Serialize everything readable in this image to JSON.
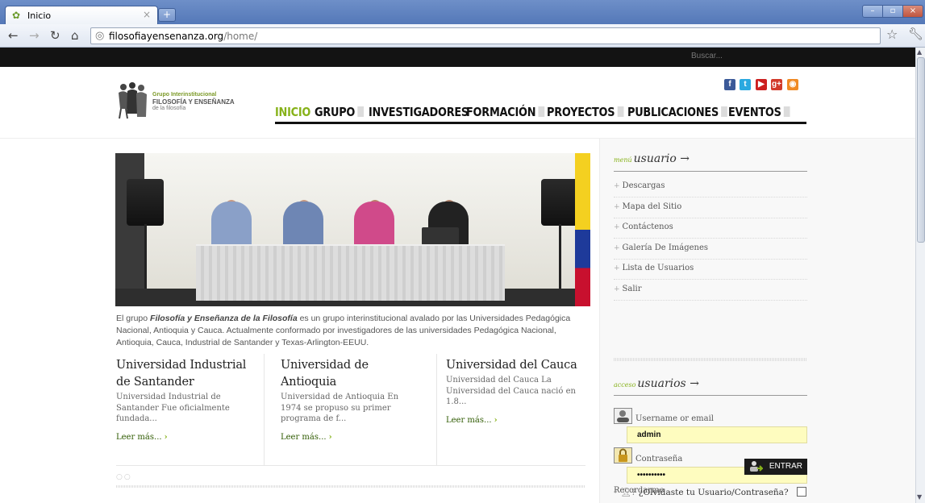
{
  "browser": {
    "tab_title": "Inicio",
    "tab_close": "×",
    "new_tab": "+",
    "url_host": "filosofiayensenanza.org",
    "url_path": "/home/",
    "win_min": "–",
    "win_max": "▫",
    "win_close": "×"
  },
  "site": {
    "search_placeholder": "Buscar...",
    "logo": {
      "line1": "Grupo Interinstitucional",
      "line2_a": "FILOSOFÍA Y ENSEÑANZA",
      "line3": "de la filosofía"
    },
    "social": [
      {
        "icon": "facebook-icon",
        "glyph": "f",
        "color": "#3b5998"
      },
      {
        "icon": "twitter-icon",
        "glyph": "t",
        "color": "#2aa9e0"
      },
      {
        "icon": "youtube-icon",
        "glyph": "▶",
        "color": "#cc2020"
      },
      {
        "icon": "google-plus-icon",
        "glyph": "g+",
        "color": "#d23a2a"
      },
      {
        "icon": "rss-icon",
        "glyph": "◉",
        "color": "#f08a24"
      }
    ],
    "nav": [
      {
        "label": "INICIO",
        "active": true,
        "dropdown": false
      },
      {
        "label": "GRUPO",
        "active": false,
        "dropdown": true
      },
      {
        "label": "INVESTIGADORES",
        "active": false,
        "dropdown": false
      },
      {
        "label": "FORMACIÓN",
        "active": false,
        "dropdown": true
      },
      {
        "label": "PROYECTOS",
        "active": false,
        "dropdown": true
      },
      {
        "label": "PUBLICACIONES",
        "active": false,
        "dropdown": true
      },
      {
        "label": "EVENTOS",
        "active": false,
        "dropdown": true
      }
    ],
    "intro": {
      "pre": "El grupo ",
      "bold": "Filosofía y Enseñanza de la Filosofía",
      "post": " es un grupo interinstitucional avalado por las Universidades Pedagógica Nacional, Antioquia y Cauca. Actualmente conformado por investigadores de las universidades Pedagógica Nacional, Antioquia, Cauca, Industrial de Santander y Texas-Arlington-EEUU."
    },
    "universities": [
      {
        "title": "Universidad Industrial de Santander",
        "text": "Universidad Industrial de Santander  Fue oficialmente fundada...",
        "more": "Leer más..."
      },
      {
        "title": "Universidad de Antioquia",
        "text": "Universidad de Antioquia En 1974 se propuso su primer programa de f...",
        "more": "Leer más..."
      },
      {
        "title": "Universidad del Cauca",
        "text": "Universidad del Cauca  La Universidad del Cauca nació en 1.8...",
        "more": "Leer más..."
      }
    ],
    "slider_dots": "○○"
  },
  "sidebar": {
    "menu_head_small": "menú",
    "menu_head_big": "usuario →",
    "menu": [
      "Descargas",
      "Mapa del Sitio",
      "Contáctenos",
      "Galería De Imágenes",
      "Lista de Usuarios",
      "Salir"
    ],
    "login_head_small": "acceso",
    "login_head_big": "usuarios →",
    "username_label": "Username or email",
    "username_value": "admin",
    "password_label": "Contraseña",
    "password_value": "••••••••••",
    "remember_label": "Recordarme",
    "login_button": "ENTRAR",
    "forgot": "¿Olvidaste tu Usuario/Contraseña?"
  }
}
